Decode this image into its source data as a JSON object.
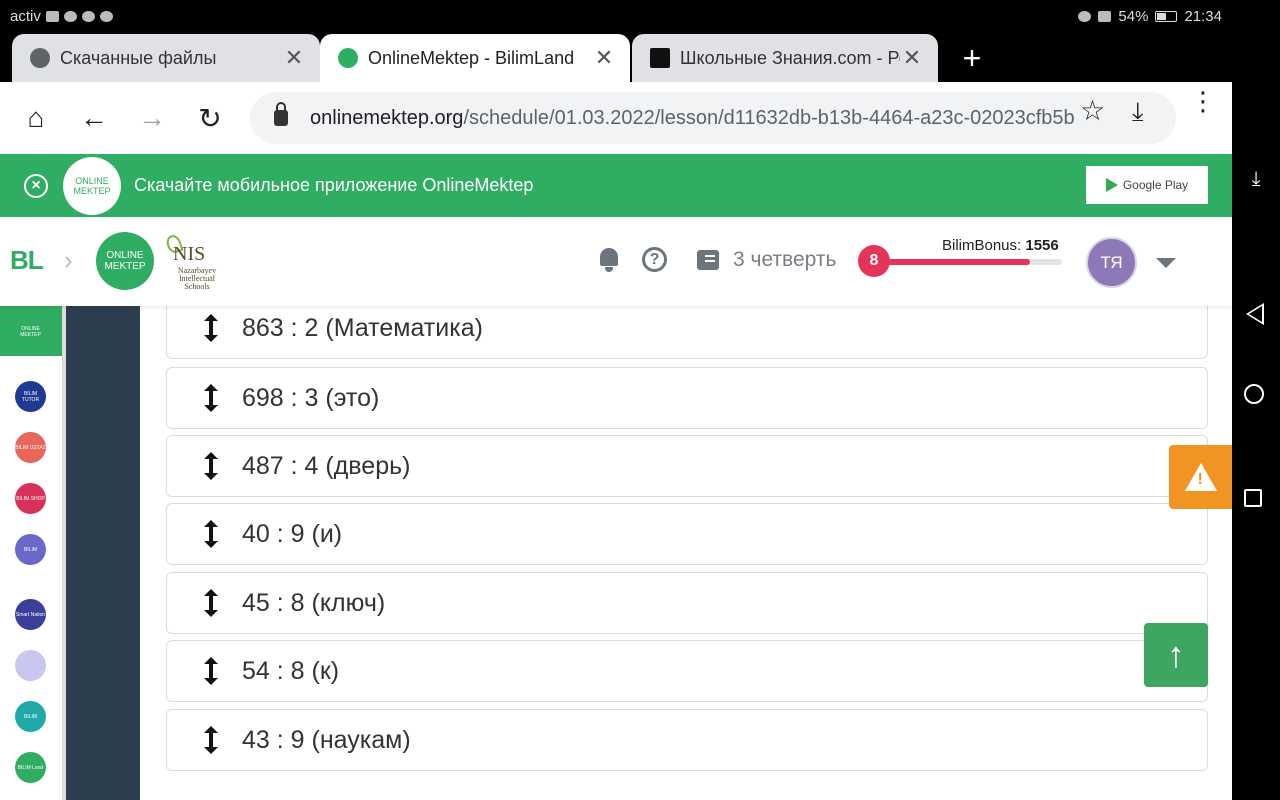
{
  "status_bar": {
    "carrier": "activ",
    "battery": "54%",
    "time": "21:34"
  },
  "tabs": [
    {
      "title": "Скачанные файлы",
      "close": "✕"
    },
    {
      "title": "OnlineMektep - BilimLand",
      "close": "✕"
    },
    {
      "title": "Школьные Знания.com - Реш",
      "close": "✕"
    }
  ],
  "new_tab": "+",
  "toolbar": {
    "url_host": "onlinemektep.org",
    "url_path": "/schedule/01.03.2022/lesson/d11632db-b13b-4464-a23c-02023cfb5b",
    "home_icon": "⌂",
    "back_icon": "←",
    "forward_icon": "→",
    "reload_icon": "↻",
    "star_icon": "☆",
    "download_icon": "⤓",
    "menu_icon": "⋮"
  },
  "banner": {
    "text": "Скачайте мобильное приложение OnlineMektep",
    "logo_text": "ONLINE MEKTEP",
    "store_button": "Google Play",
    "close_icon": "×"
  },
  "header": {
    "bl_logo": "BL",
    "chevron": "›",
    "om_logo": "ONLINE MEKTEP",
    "nis_big": "NIS",
    "nis_small": "Nazarbayev Intellectual Schools",
    "help_icon": "?",
    "quarter": "3 четверть",
    "bonus_label": "BilimBonus:",
    "bonus_value": "1556",
    "bonus_progress": 0.83,
    "level": "8",
    "avatar_initials": "ТЯ",
    "colors": {
      "accent": "#2fad62",
      "bonus": "#e6335a",
      "avatar": "#8d79b8"
    }
  },
  "sidebar": {
    "items": [
      {
        "label": "ONLINE MEKTEP",
        "color": "#2fad62"
      },
      {
        "label": "BILIM TUTOR",
        "color": "#1f3a93"
      },
      {
        "label": "BILIM USTAZ",
        "color": "#e8665a"
      },
      {
        "label": "BILIM SHOP",
        "color": "#d9325a"
      },
      {
        "label": "BILIM",
        "color": "#6a68c8"
      },
      {
        "label": "Smart Nation",
        "color": "#3a3f9a"
      },
      {
        "label": "",
        "color": "#c9c6ef"
      },
      {
        "label": "BILIM",
        "color": "#21a8a8"
      },
      {
        "label": "BILIM Land",
        "color": "#2fad62"
      }
    ]
  },
  "rows": [
    "863 : 2 (Математика)",
    "698 : 3 (это)",
    "487 : 4 (дверь)",
    "40 : 9 (и)",
    "45 : 8 (ключ)",
    "54 : 8 (к)",
    "43 : 9 (наукам)"
  ],
  "warn_icon": "!",
  "scroll_up_icon": "↑",
  "nav": {
    "collapse_icon": "⤓"
  }
}
